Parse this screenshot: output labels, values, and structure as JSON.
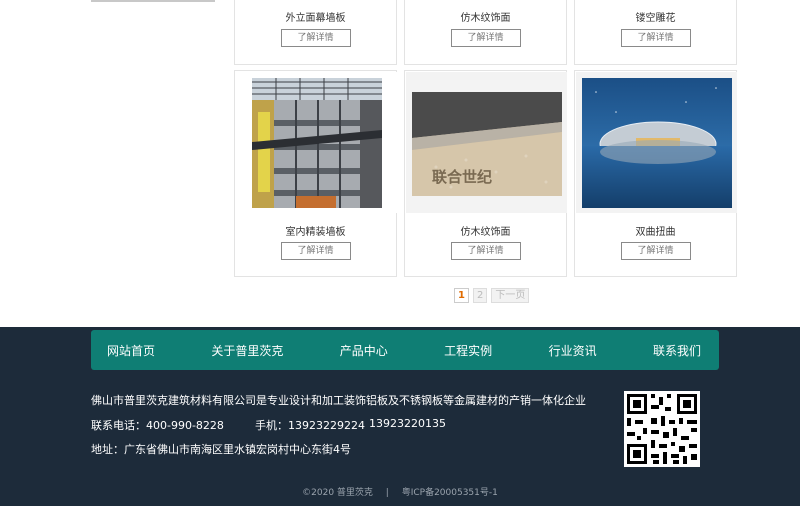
{
  "products_top": [
    {
      "title": "外立面幕墙板",
      "button": "了解详情"
    },
    {
      "title": "仿木纹饰面",
      "button": "了解详情"
    },
    {
      "title": "镂空雕花",
      "button": "了解详情"
    }
  ],
  "products_bottom": [
    {
      "title": "室内精装墙板",
      "button": "了解详情",
      "image": "atrium-building-photo"
    },
    {
      "title": "仿木纹饰面",
      "button": "了解详情",
      "image": "panel-sample-photo",
      "image_text": "联合世纪"
    },
    {
      "title": "双曲扭曲",
      "button": "了解详情",
      "image": "grand-theatre-photo"
    }
  ],
  "pagination": {
    "pages": [
      "1",
      "2"
    ],
    "current": "1",
    "next": "下一页"
  },
  "footer": {
    "nav": [
      "网站首页",
      "关于普里茨克",
      "产品中心",
      "工程实例",
      "行业资讯",
      "联系我们"
    ],
    "description": "佛山市普里茨克建筑材料有限公司是专业设计和加工装饰铝板及不锈钢板等金属建材的产销一体化企业",
    "phone_label": "联系电话：400-990-8228",
    "mobile_label": "手机：13923229224",
    "mobile2": "13923220135",
    "address": "地址：广东省佛山市南海区里水镇宏岗村中心东街4号",
    "copyright": "©2020 普里茨克",
    "separator": "|",
    "icp": "粤ICP备20005351号-1"
  },
  "colors": {
    "nav_bg": "#0f7e74",
    "footer_bg": "#1d2b3a",
    "page_current": "#e06b00"
  }
}
